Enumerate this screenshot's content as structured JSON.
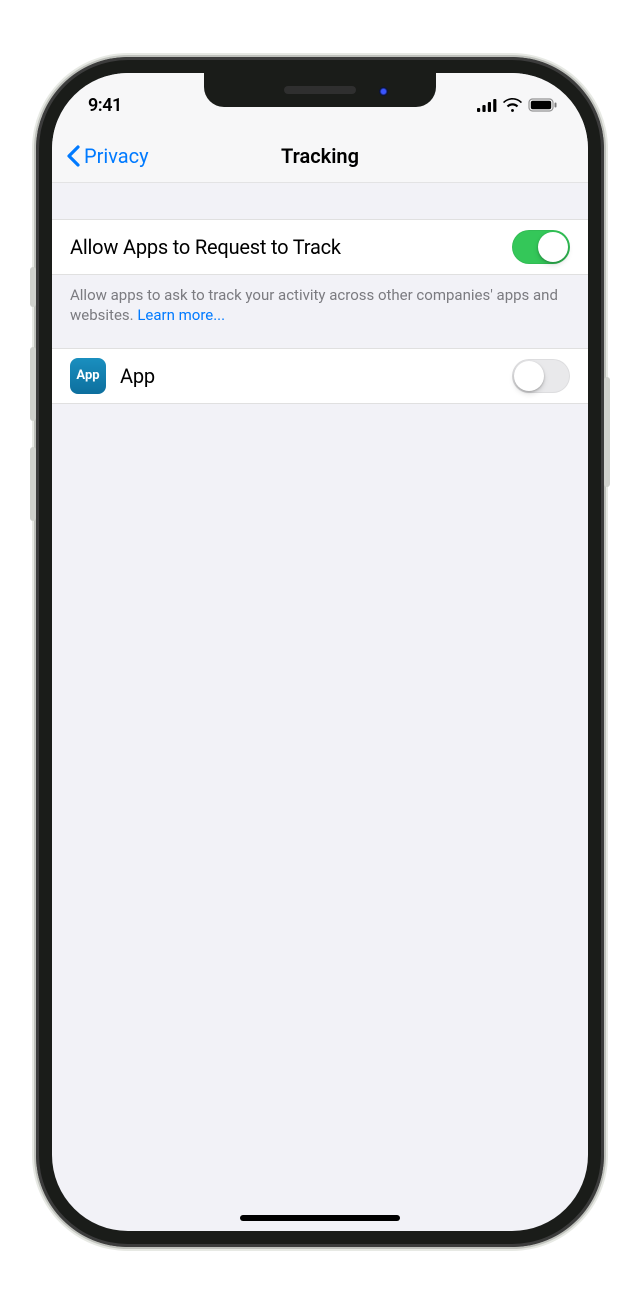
{
  "statusbar": {
    "time": "9:41"
  },
  "nav": {
    "back_label": "Privacy",
    "title": "Tracking"
  },
  "settings": {
    "allow_request_label": "Allow Apps to Request to Track",
    "allow_request_on": true,
    "helper_text": "Allow apps to ask to track your activity across other companies' apps and websites. ",
    "learn_more": "Learn more..."
  },
  "apps": [
    {
      "icon_text": "App",
      "name": "App",
      "tracking_on": false
    }
  ]
}
